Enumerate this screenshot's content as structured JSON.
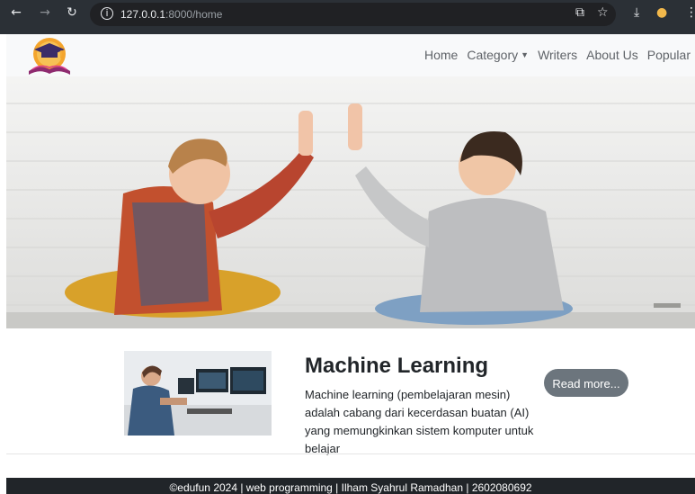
{
  "browser": {
    "url_host": "127.0.0.1",
    "url_path": ":8000/home",
    "back_icon": "arrow-left-icon",
    "forward_icon": "arrow-right-icon",
    "reload_icon": "reload-icon"
  },
  "navbar": {
    "items": [
      {
        "label": "Home"
      },
      {
        "label": "Category"
      },
      {
        "label": "Writers"
      },
      {
        "label": "About Us"
      },
      {
        "label": "Popular"
      }
    ]
  },
  "card": {
    "title": "Machine Learning",
    "description": "Machine learning (pembelajaran mesin) adalah cabang dari kecerdasan buatan (AI) yang memungkinkan sistem komputer untuk belajar",
    "button": "Read more..."
  },
  "footer": {
    "text": "©edufun 2024 | web programming | Ilham Syahrul Ramadhan | 2602080692"
  },
  "colors": {
    "navbar_bg": "#f8f9fa",
    "button_bg": "#6c757d",
    "footer_bg": "#212529",
    "chrome_bg": "#2b3036"
  }
}
